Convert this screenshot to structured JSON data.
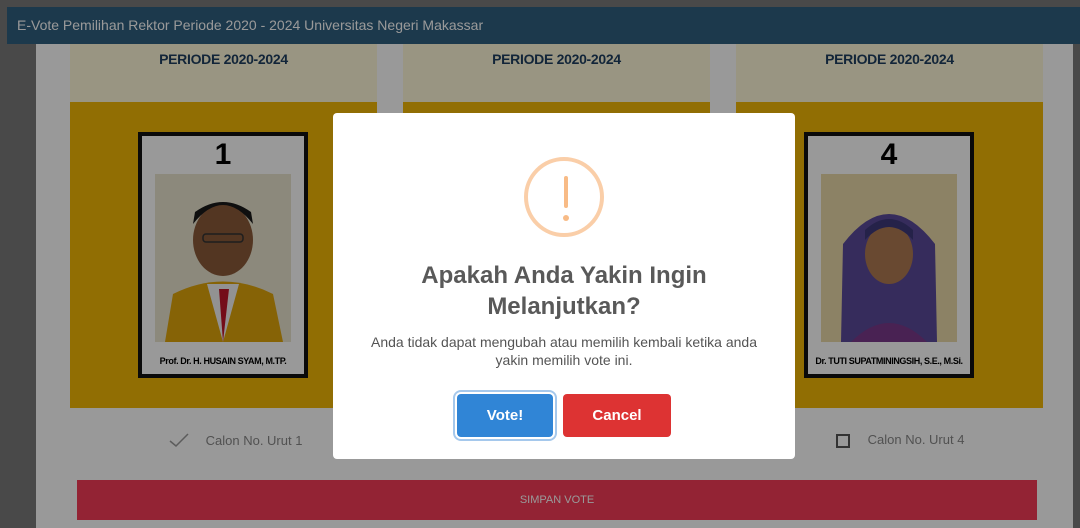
{
  "topbar": {
    "title_prefix": "E-Vote Pemilihan Rektor Periode 2020 - 2024",
    "title_institution": "Universitas Negeri Makassar"
  },
  "candidates": [
    {
      "period": "PERIODE 2020-2024",
      "number": "1",
      "name": "Prof. Dr. H. HUSAIN SYAM, M.TP.",
      "choice_label": "Calon No. Urut 1",
      "choice_state": "checked"
    },
    {
      "period": "PERIODE 2020-2024",
      "number": "",
      "name": "",
      "choice_label": "",
      "choice_state": ""
    },
    {
      "period": "PERIODE 2020-2024",
      "number": "4",
      "name": "Dr. TUTI SUPATMININGSIH, S.E., M.Si.",
      "choice_label": "Calon No. Urut 4",
      "choice_state": "unchecked"
    }
  ],
  "save_button": "SIMPAN VOTE",
  "modal": {
    "icon": "warning-icon",
    "title": "Apakah Anda Yakin Ingin Melanjutkan?",
    "text": "Anda tidak dapat mengubah atau memilih kembali ketika anda yakin memilih vote ini.",
    "confirm_label": "Vote!",
    "cancel_label": "Cancel"
  },
  "colors": {
    "topbar": "#2f5f7f",
    "card_gold": "#f2b705",
    "save_button": "#f53b57",
    "confirm": "#3085d6",
    "cancel": "#dd3333",
    "warning": "#f8bb86"
  }
}
